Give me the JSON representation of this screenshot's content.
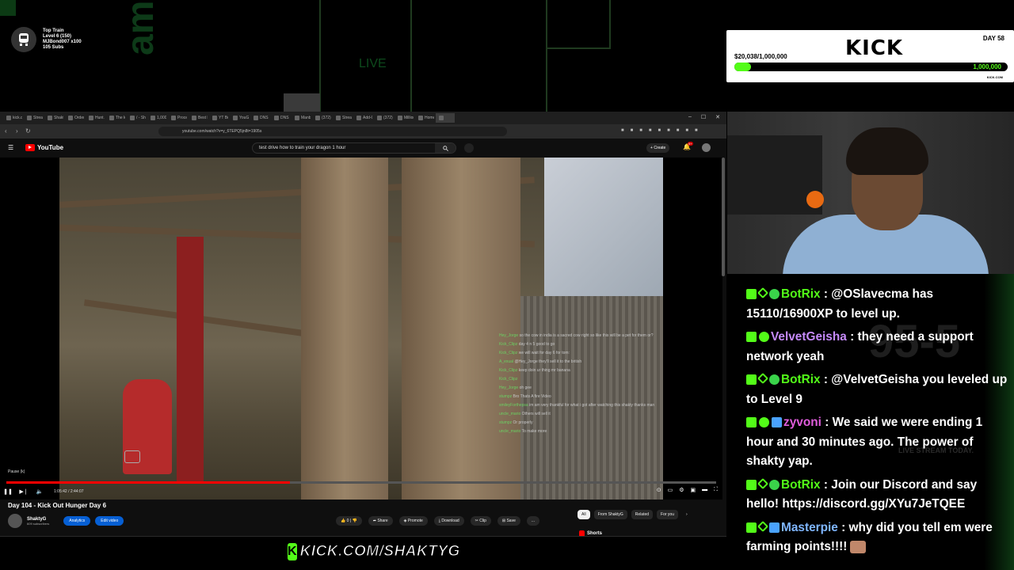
{
  "overlay": {
    "train": [
      "Top Train",
      "Level 6 (150)",
      "MJBond007 x100",
      "105 Subs"
    ],
    "bg_live": "LIVE",
    "goal": {
      "day": "DAY 58",
      "brand": "KICK",
      "amount": "$20,038/1,000,000",
      "target": "1,000,000",
      "site": "KICK.COM",
      "progress_fraction": 0.02
    },
    "banner": "KICK.COM/SHAKTYG"
  },
  "browser": {
    "tabs": [
      "kick.c",
      "Stream",
      "Shakty",
      "Order",
      "Hunt An",
      "The kn",
      "/ - Sh",
      "1,000",
      "Proces",
      "Best B",
      "YT Bo",
      "YouGo",
      "DNS R",
      "DNS R",
      "Manbi",
      "(372)",
      "Stream",
      "Add-Gr",
      "(372)",
      "Million",
      "Home",
      ""
    ],
    "active_tab_index": 21,
    "url": "youtube.com/watch?v=y_6TEPQ5jn8t=1905s",
    "win_controls": [
      "–",
      "☐",
      "✕"
    ]
  },
  "youtube": {
    "logo": "YouTube",
    "search_value": "test drive how to train your dragon 1 hour",
    "create_label": "Create",
    "notif_count": "9+",
    "video": {
      "pause_tip": "Pause (k)",
      "time": "1:05:42 / 2:44:07",
      "progress_fraction": 0.4,
      "chat_lines": [
        {
          "user": "Hey_Jorge",
          "text": "so the cow in india is a sacred cow right so like this will be a pet for them or?"
        },
        {
          "user": "Kick_Clipz",
          "text": "day 4 n 5 good to go"
        },
        {
          "user": "Kick_Clipz",
          "text": "we will wait for day 6 for tom:"
        },
        {
          "user": "A_exual",
          "text": "@Hey_Jorge they'll sell it to the british"
        },
        {
          "user": "Kick_Clipz",
          "text": "keep doin ur thing mr banana"
        },
        {
          "user": "Kick_Clipz",
          "text": ""
        },
        {
          "user": "Hey_Jorge",
          "text": "oh gee"
        },
        {
          "user": "stumpz",
          "text": "Bro Thats A fire Video"
        },
        {
          "user": "smileyForthepsa",
          "text": "im am very thankful for what i got after watching this shakty thanks man"
        },
        {
          "user": "uncle_mario",
          "text": "Others will sell it"
        },
        {
          "user": "stumpz",
          "text": "Or properly"
        },
        {
          "user": "uncle_mario",
          "text": "To make more"
        }
      ]
    },
    "title": "Day 104 - Kick Out Hunger Day 6",
    "channel": {
      "name": "ShaktyG",
      "subs": "609 subscribers"
    },
    "owner_buttons": [
      "Analytics",
      "Edit video"
    ],
    "actions": [
      "0",
      "",
      "Share",
      "Promote",
      "Download",
      "Clip",
      "Save",
      "..."
    ],
    "chips": [
      "All",
      "From ShaktyG",
      "Related",
      "For you"
    ],
    "shorts_label": "Shorts"
  },
  "chat": {
    "bg_number": "95-5",
    "bg_text": "LIVE STREAM TODAY.",
    "messages": [
      {
        "user": "BotRix",
        "user_color": "#53fc18",
        "text": ": @OSlavecma has 15110/16900XP to level up."
      },
      {
        "user": "VelvetGeisha",
        "user_color": "#c58af9",
        "text": ": they need a support network yeah"
      },
      {
        "user": "BotRix",
        "user_color": "#53fc18",
        "text": ": @VelvetGeisha you leveled up to Level 9"
      },
      {
        "user": "zyvoni",
        "user_color": "#e05ddc",
        "text": ": We said we were ending 1 hour and 30 minutes ago. The power of shakty yap."
      },
      {
        "user": "BotRix",
        "user_color": "#53fc18",
        "text": ": Join our Discord and say hello! https://discord.gg/XYu7JeTQEE"
      },
      {
        "user": "Masterpie",
        "user_color": "#7fb6ff",
        "text": ": why did you tell em were farming points!!!!"
      }
    ]
  }
}
